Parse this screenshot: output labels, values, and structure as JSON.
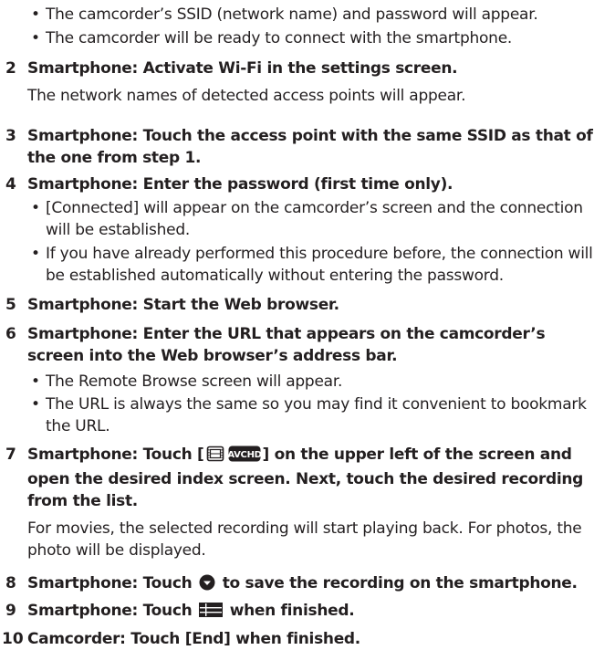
{
  "intro_bullets": [
    "The camcorder’s SSID (network name) and password will appear.",
    "The camcorder will be ready to connect with the smartphone."
  ],
  "steps": [
    {
      "num": "2",
      "title": "Smartphone: Activate Wi-Fi in the settings screen.",
      "note": "The network names of detected access points will appear."
    },
    {
      "num": "3",
      "title": "Smartphone: Touch the access point with the same SSID as that of the one from step 1."
    },
    {
      "num": "4",
      "title": "Smartphone: Enter the password (first time only).",
      "bullets": [
        "[Connected] will appear on the camcorder’s screen and the connection will be established.",
        "If you have already performed this procedure before, the connection will be established automatically without entering the password."
      ]
    },
    {
      "num": "5",
      "title": "Smartphone: Start the Web browser."
    },
    {
      "num": "6",
      "title": "Smartphone: Enter the URL that appears on the camcorder’s screen into the Web browser’s address bar.",
      "bullets": [
        "The Remote Browse screen will appear.",
        "The URL is always the same so you may find it convenient to bookmark the URL."
      ]
    },
    {
      "num": "7",
      "title_prefix": "Smartphone: Touch [",
      "icon_text": "AVCHD",
      "title_suffix": "] on the upper left of the screen and open the desired index screen. Next, touch the desired recording from the list.",
      "note": "For movies, the selected recording will start playing back. For photos, the photo will be displayed."
    },
    {
      "num": "8",
      "title_prefix": "Smartphone: Touch",
      "title_suffix": "to save the recording on the smartphone."
    },
    {
      "num": "9",
      "title_prefix": "Smartphone: Touch",
      "title_suffix": "when finished."
    },
    {
      "num": "10",
      "title": "Camcorder: Touch [End] when finished."
    }
  ],
  "icons": {
    "step7_index": "movie-index-icon",
    "step7_format": "avchd-icon",
    "step8_save": "save-download-icon",
    "step9_menu": "list-menu-icon"
  }
}
